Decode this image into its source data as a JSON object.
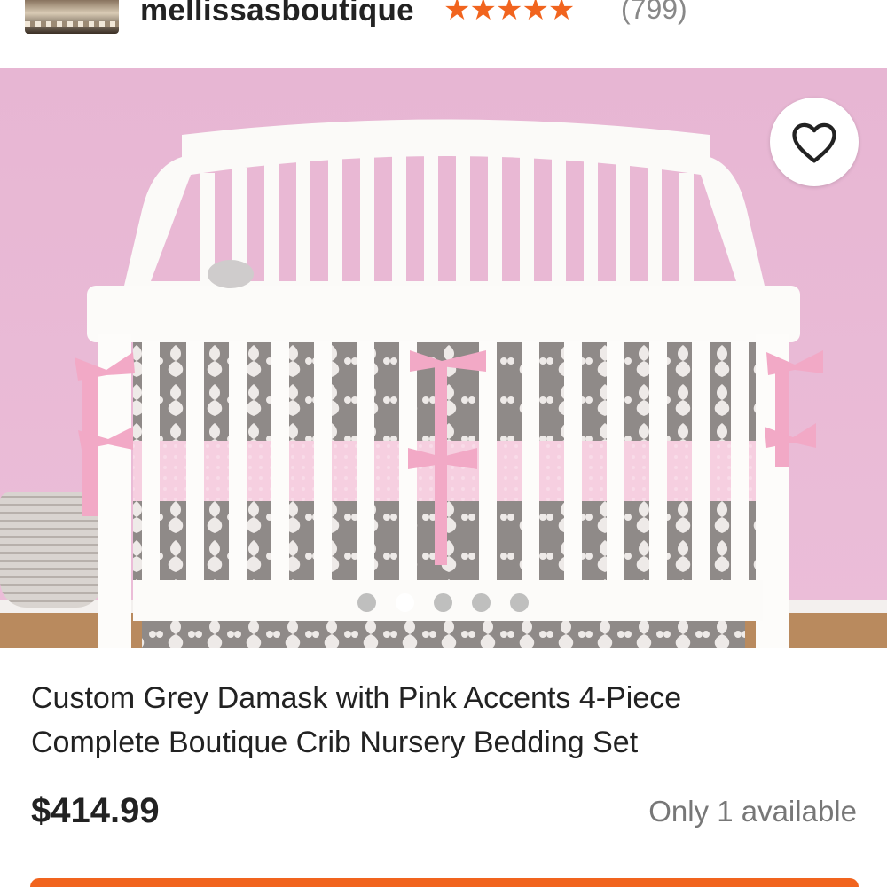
{
  "shop": {
    "name": "mellissasboutique",
    "stars_text": "★★★★★",
    "rating": 5,
    "review_count": "(799)"
  },
  "gallery": {
    "favorite_icon": "heart-outline-icon",
    "dots": 5,
    "active_dot": 2
  },
  "product": {
    "title_line1": "Custom Grey Damask with Pink Accents 4-Piece",
    "title_line2": "Complete Boutique Crib Nursery Bedding Set",
    "price": "$414.99",
    "availability": "Only 1 available"
  },
  "colors": {
    "accent": "#f1641e",
    "star": "#f1641e"
  }
}
